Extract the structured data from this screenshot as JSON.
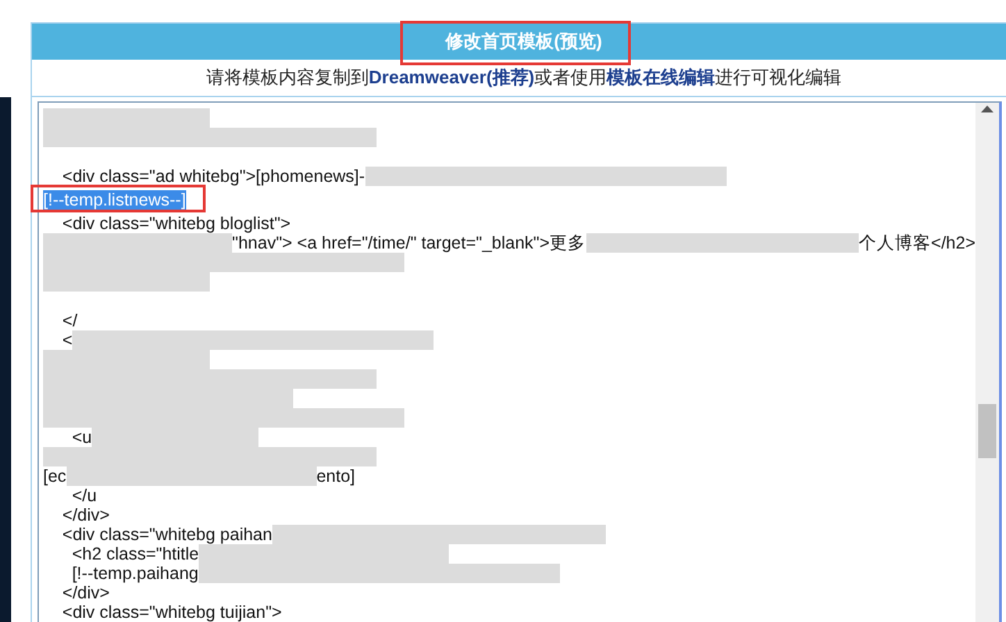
{
  "panel": {
    "title": "修改首页模板(预览)",
    "hint": "请将模板内容复制到**Dreamweaver(推荐)**或者使用**模板在线编辑**进行可视化编辑"
  },
  "editor": {
    "lines": [
      {
        "kind": "code",
        "segments": [
          {
            "kind": "redacted"
          }
        ]
      },
      {
        "kind": "code",
        "segments": [
          {
            "kind": "redacted"
          }
        ]
      },
      {
        "kind": "blank"
      },
      {
        "kind": "code",
        "segments": [
          {
            "kind": "text",
            "text": "    <div class=\"ad whitebg\">[phomenews]-"
          },
          {
            "kind": "redacted"
          }
        ]
      },
      {
        "kind": "code",
        "segments": [
          {
            "kind": "selection",
            "text": "[!--temp.listnews--]"
          }
        ]
      },
      {
        "kind": "code",
        "segments": [
          {
            "kind": "text",
            "text": "    <div class=\"whitebg bloglist\">"
          }
        ]
      },
      {
        "kind": "code",
        "segments": [
          {
            "kind": "redacted"
          },
          {
            "kind": "text",
            "text": "\"hnav\"> <a href=\"/time/\" target=\"_blank\">更多"
          },
          {
            "kind": "redacted"
          },
          {
            "kind": "text",
            "text": "个人博客</h2>"
          }
        ]
      },
      {
        "kind": "code",
        "segments": [
          {
            "kind": "redacted"
          }
        ]
      },
      {
        "kind": "code",
        "segments": [
          {
            "kind": "redacted"
          }
        ]
      },
      {
        "kind": "blank"
      },
      {
        "kind": "code",
        "segments": [
          {
            "kind": "text",
            "text": "    </"
          }
        ]
      },
      {
        "kind": "code",
        "segments": [
          {
            "kind": "text",
            "text": "    <"
          },
          {
            "kind": "redacted"
          }
        ]
      },
      {
        "kind": "code",
        "segments": [
          {
            "kind": "redacted"
          }
        ]
      },
      {
        "kind": "code",
        "segments": [
          {
            "kind": "redacted"
          }
        ]
      },
      {
        "kind": "code",
        "segments": [
          {
            "kind": "redacted"
          }
        ]
      },
      {
        "kind": "code",
        "segments": [
          {
            "kind": "redacted"
          }
        ]
      },
      {
        "kind": "code",
        "segments": [
          {
            "kind": "text",
            "text": "      <u"
          },
          {
            "kind": "redacted"
          }
        ]
      },
      {
        "kind": "code",
        "segments": [
          {
            "kind": "redacted"
          }
        ]
      },
      {
        "kind": "code",
        "segments": [
          {
            "kind": "text",
            "text": "[ec"
          },
          {
            "kind": "redacted"
          },
          {
            "kind": "text",
            "text": "ento]"
          }
        ]
      },
      {
        "kind": "code",
        "segments": [
          {
            "kind": "text",
            "text": "      </u"
          }
        ]
      },
      {
        "kind": "code",
        "segments": [
          {
            "kind": "text",
            "text": "    </div>"
          }
        ]
      },
      {
        "kind": "code",
        "segments": [
          {
            "kind": "text",
            "text": "    <div class=\"whitebg paihan"
          },
          {
            "kind": "redacted"
          }
        ]
      },
      {
        "kind": "code",
        "segments": [
          {
            "kind": "text",
            "text": "      <h2 class=\"htitle"
          },
          {
            "kind": "redacted"
          }
        ]
      },
      {
        "kind": "code",
        "segments": [
          {
            "kind": "text",
            "text": "      [!--temp.paihang"
          },
          {
            "kind": "redacted"
          }
        ]
      },
      {
        "kind": "code",
        "segments": [
          {
            "kind": "text",
            "text": "    </div>"
          }
        ]
      },
      {
        "kind": "code",
        "segments": [
          {
            "kind": "text",
            "text": "    <div class=\"whitebg tuijian\">"
          }
        ]
      }
    ]
  }
}
